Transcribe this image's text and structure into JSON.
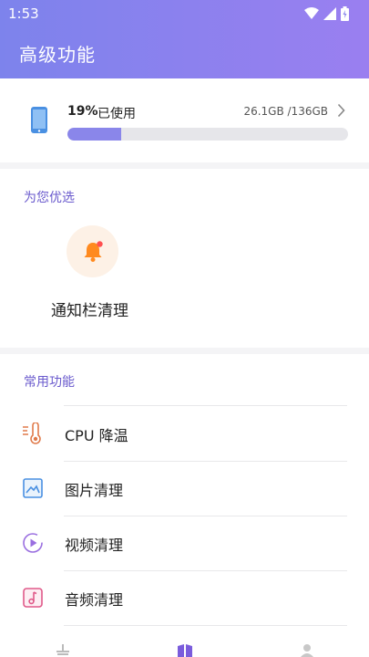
{
  "status_bar": {
    "time": "1:53",
    "icons": [
      "wifi-icon",
      "signal-icon",
      "battery-icon"
    ]
  },
  "header": {
    "title": "高级功能"
  },
  "storage": {
    "percent_label": "19%",
    "used_label": "已使用",
    "size_text": "26.1GB /136GB",
    "progress": 0.19
  },
  "recommended": {
    "title": "为您优选",
    "items": [
      {
        "label": "通知栏清理",
        "icon": "bell-icon"
      }
    ]
  },
  "common": {
    "title": "常用功能",
    "items": [
      {
        "label": "CPU 降温",
        "icon": "thermometer-icon"
      },
      {
        "label": "图片清理",
        "icon": "image-icon"
      },
      {
        "label": "视频清理",
        "icon": "play-icon"
      },
      {
        "label": "音频清理",
        "icon": "music-icon"
      }
    ]
  },
  "bottom_nav": {
    "icons": [
      "broom-icon",
      "features-icon",
      "profile-icon"
    ]
  },
  "colors": {
    "accent": "#8a86ea",
    "section_title": "#6a5acd",
    "bell": "#ff8a1f"
  }
}
